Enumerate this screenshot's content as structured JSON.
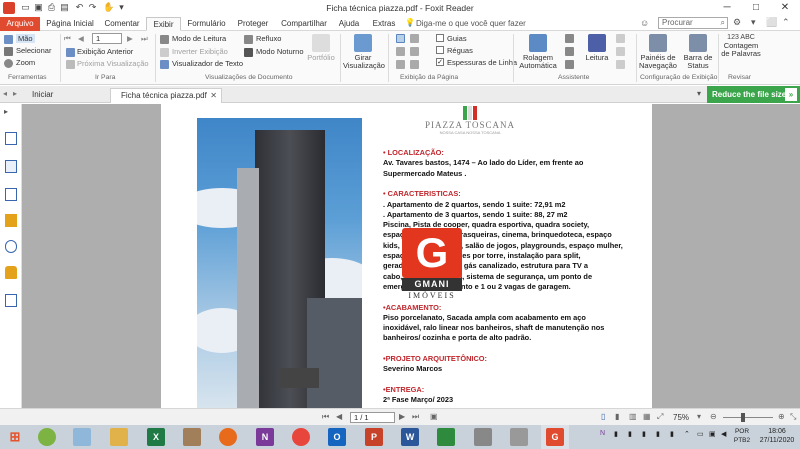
{
  "window": {
    "title": "Ficha técnica piazza.pdf - Foxit Reader",
    "controls": [
      "─",
      "□",
      "✕"
    ]
  },
  "ribbon_tabs": [
    "Arquivo",
    "Página Inicial",
    "Comentar",
    "Exibir",
    "Formulário",
    "Proteger",
    "Compartilhar",
    "Ajuda",
    "Extras"
  ],
  "tell_me": "Diga-me o que você quer fazer",
  "search": {
    "placeholder": "Procurar"
  },
  "ribbon": {
    "tools": {
      "hand": "Mão",
      "select": "Selecionar",
      "zoom": "Zoom",
      "group": "Ferramentas"
    },
    "goto": {
      "page_value": "1",
      "previous_view": "Exibição Anterior",
      "next_view": "Próxima Visualização",
      "group": "Ir Para"
    },
    "docviews": {
      "reading_mode": "Modo de Leitura",
      "reflow": "Refluxo",
      "invert_view": "Inverter Exibição",
      "night_mode": "Modo Noturno",
      "text_viewer": "Visualizador de Texto",
      "portfolio": "Portfólio",
      "group": "Visualizações de Documento"
    },
    "rotate": {
      "label1": "Girar",
      "label2": "Visualização"
    },
    "pageview": {
      "guides": "Guias",
      "rulers": "Réguas",
      "line_weights": "Espessuras de Linha",
      "group": "Exibição da Página"
    },
    "assistant": {
      "autoscroll1": "Rolagem",
      "autoscroll2": "Automática",
      "read": "Leitura",
      "group": "Assistente"
    },
    "viewsettings": {
      "nav_panels1": "Painéis de",
      "nav_panels2": "Navegação",
      "status_bar1": "Barra de",
      "status_bar2": "Status",
      "group": "Configuração de Exibição"
    },
    "review": {
      "word_count_icon": "123 ABC",
      "word_count1": "Contagem",
      "word_count2": "de Palavras",
      "group": "Revisar"
    }
  },
  "doc_tabs": [
    "Iniciar",
    "Ficha técnica piazza.pdf"
  ],
  "reduce_banner": "Reduce the file size",
  "document": {
    "logo_text": "PIAZZA TOSCANA",
    "logo_subtext": "NOSSA CASA NOSSA TOSCANA",
    "lines": [
      {
        "text": "• LOCALIZAÇÃO:",
        "style": "red"
      },
      {
        "text": "Av. Tavares bastos, 1474 – Ao lado do Líder, em frente ao",
        "style": "b"
      },
      {
        "text": "Supermercado Mateus .",
        "style": "b"
      },
      {
        "text": "",
        "style": ""
      },
      {
        "text": "• CARACTERISTICAS:",
        "style": "red"
      },
      {
        "text": ". Apartamento de 2 quartos, sendo 1 suite: 72,91 m2",
        "style": "b"
      },
      {
        "text": ". Apartamento de 3 quartos, sendo 1 suite: 88, 27 m2",
        "style": "b"
      },
      {
        "text": "Piscina, Pista de cooper, quadra esportiva, quadra society,",
        "style": "b"
      },
      {
        "text": "espaço gourmet, churrasqueiras, cinema, brinquedoteca, espaço",
        "style": "b"
      },
      {
        "text": "kids, sala de ginástica, salão de jogos, playgrounds, espaço mulher,",
        "style": "b"
      },
      {
        "text": "espaço pet, 2 elevadores por torre, instalação para split,",
        "style": "b"
      },
      {
        "text": "gerador, aquecimento, gás canalizado, estrutura para TV a",
        "style": "b"
      },
      {
        "text": "cabo, espaço de carga, sistema de segurança, um ponto de",
        "style": "b"
      },
      {
        "text": "emergência, apartamento e 1 ou 2 vagas de garagem.",
        "style": "b"
      },
      {
        "text": "",
        "style": ""
      },
      {
        "text": "•ACABAMENTO:",
        "style": "red"
      },
      {
        "text": "Piso porcelanato, Sacada ampla com acabamento em aço",
        "style": "b"
      },
      {
        "text": "inoxidável, ralo linear nos banheiros, shaft de manutenção nos",
        "style": "b"
      },
      {
        "text": "banheiros/ cozinha e porta de alto padrão.",
        "style": "b"
      },
      {
        "text": "",
        "style": ""
      },
      {
        "text": "•PROJETO ARQUITETÔNICO:",
        "style": "red"
      },
      {
        "text": "Severino Marcos",
        "style": "b"
      },
      {
        "text": "",
        "style": ""
      },
      {
        "text": "•ENTREGA:",
        "style": "red"
      },
      {
        "text": "2ª Fase Março/ 2023",
        "style": "b"
      }
    ],
    "watermark_letter": "G",
    "watermark_name": "GMANI",
    "watermark_sub": "IMÓVEIS"
  },
  "statusbar": {
    "page_value": "1 / 1",
    "zoom": "75%"
  },
  "taskbar": {
    "tray_lang1": "POR",
    "tray_lang2": "PTB2",
    "clock_time": "18:06",
    "clock_date": "27/11/2020"
  },
  "colors": {
    "file_tab": "#e04a2e",
    "reduce_banner": "#3aa54a",
    "doc_heading": "#c0272d",
    "watermark": "#e2371e"
  }
}
